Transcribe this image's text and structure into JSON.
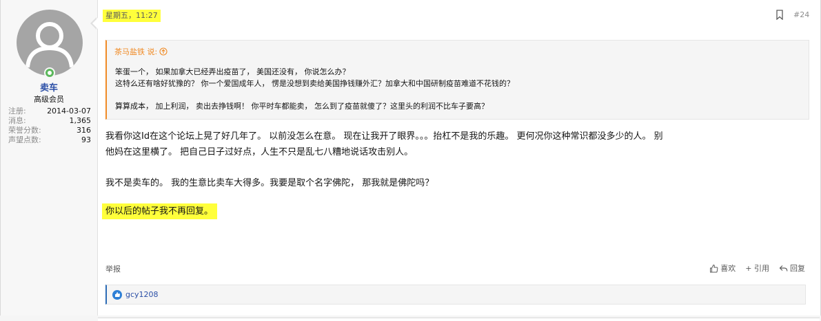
{
  "user": {
    "name": "卖车",
    "title": "高级会员",
    "stats": [
      {
        "label": "注册:",
        "value": "2014-03-07"
      },
      {
        "label": "消息:",
        "value": "1,365"
      },
      {
        "label": "荣誉分数:",
        "value": "316"
      },
      {
        "label": "声望点数:",
        "value": "93"
      }
    ]
  },
  "post": {
    "timestamp": "星期五，11:27",
    "number": "#24",
    "quote": {
      "author_line": "茶马盐铁 说:",
      "lines": [
        "笨蛋一个， 如果加拿大已经弄出疫苗了， 美国还没有， 你说怎么办？",
        "这特么还有啥好犹豫的？ 你一个爱国成年人， 愣是没想到卖给美国挣钱赚外汇？加拿大和中国研制疫苗难道不花钱的？",
        "算算成本， 加上利润， 卖出去挣钱啊！ 你平时车都能卖， 怎么到了疫苗就傻了？这里头的利润不比车子要高？"
      ]
    },
    "body": [
      "我看你这Id在这个论坛上晃了好几年了。 以前没怎么在意。 现在让我开了眼界。。。抬杠不是我的乐趣。 更何况你这种常识都没多少的人。 别",
      "他妈在这里横了。 把自己日子过好点，人生不只是乱七八糟地说话攻击别人。",
      "我不是卖车的。 我的生意比卖车大得多。我要是取个名字佛陀， 那我就是佛陀吗？",
      "你以后的帖子我不再回复。"
    ],
    "report_label": "举报",
    "actions": {
      "like": "喜欢",
      "quote": "+ 引用",
      "reply": "回复"
    },
    "liked_by": "gcy1208"
  },
  "colors": {
    "highlight": "#ffff3b",
    "quote_accent": "#f08a24",
    "link": "#2a4ea6"
  }
}
